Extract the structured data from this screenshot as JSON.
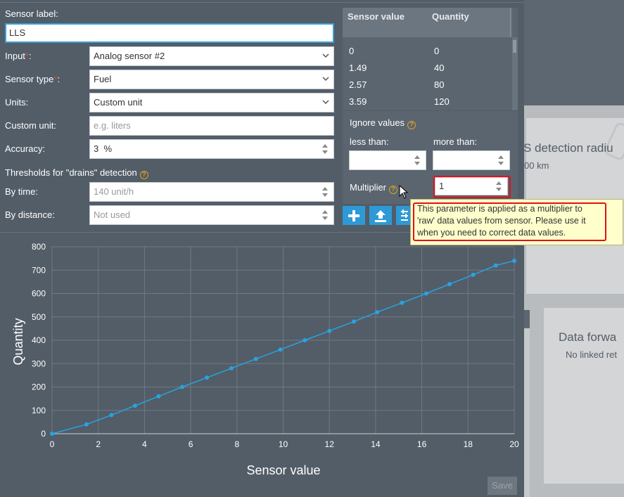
{
  "background": {
    "gps_card_title": "S detection radiu",
    "gps_card_sub": "00 km",
    "df_card_title": "Data forwa",
    "df_card_sub": "No linked ret"
  },
  "form": {
    "sensor_label_caption": "Sensor label:",
    "sensor_label_value": "LLS",
    "input_caption": "Input",
    "input_value": "Analog sensor #2",
    "sensor_type_caption": "Sensor type",
    "sensor_type_value": "Fuel",
    "units_caption": "Units:",
    "units_value": "Custom unit",
    "custom_unit_caption": "Custom unit:",
    "custom_unit_placeholder": "e.g. liters",
    "accuracy_caption": "Accuracy:",
    "accuracy_value": "3  %",
    "thresholds_caption": "Thresholds for \"drains\" detection",
    "by_time_caption": "By time:",
    "by_time_value": "140 unit/h",
    "by_distance_caption": "By distance:",
    "by_distance_value": "Not used",
    "required_mark": "*",
    "colon": ":"
  },
  "table": {
    "col_sensor_value": "Sensor value",
    "col_quantity": "Quantity",
    "rows": [
      {
        "sensor": "0",
        "qty": "0"
      },
      {
        "sensor": "1.49",
        "qty": "40"
      },
      {
        "sensor": "2.57",
        "qty": "80"
      },
      {
        "sensor": "3.59",
        "qty": "120"
      }
    ]
  },
  "ignore": {
    "title": "Ignore values",
    "less_than": "less than:",
    "more_than": "more than:",
    "multiplier_caption": "Multiplier",
    "multiplier_value": "1"
  },
  "tooltip": {
    "text": "This parameter is applied as a multiplier to 'raw' data values from sensor. Please use it when you need to correct data values."
  },
  "save_label": "Save",
  "help_glyph": "?",
  "colors": {
    "accent": "#2d9ad7",
    "highlight": "#e0101a",
    "series": "#29a3e0"
  },
  "chart_data": {
    "type": "line",
    "xlabel": "Sensor value",
    "ylabel": "Quantity",
    "xlim": [
      0,
      20
    ],
    "ylim": [
      0,
      800
    ],
    "xticks": [
      0,
      2,
      4,
      6,
      8,
      10,
      12,
      14,
      16,
      18,
      20
    ],
    "yticks": [
      0,
      100,
      200,
      300,
      400,
      500,
      600,
      700,
      800
    ],
    "grid": true,
    "series": [
      {
        "x": [
          0,
          1.49,
          2.57,
          3.59,
          4.61,
          5.63,
          6.7,
          7.76,
          8.82,
          9.88,
          10.94,
          12.0,
          13.06,
          14.07,
          15.14,
          16.19,
          17.2,
          18.22,
          19.2,
          20.0
        ],
        "y": [
          0,
          40,
          80,
          120,
          160,
          200,
          240,
          280,
          320,
          360,
          400,
          440,
          480,
          520,
          560,
          600,
          640,
          680,
          720,
          740
        ]
      }
    ]
  }
}
